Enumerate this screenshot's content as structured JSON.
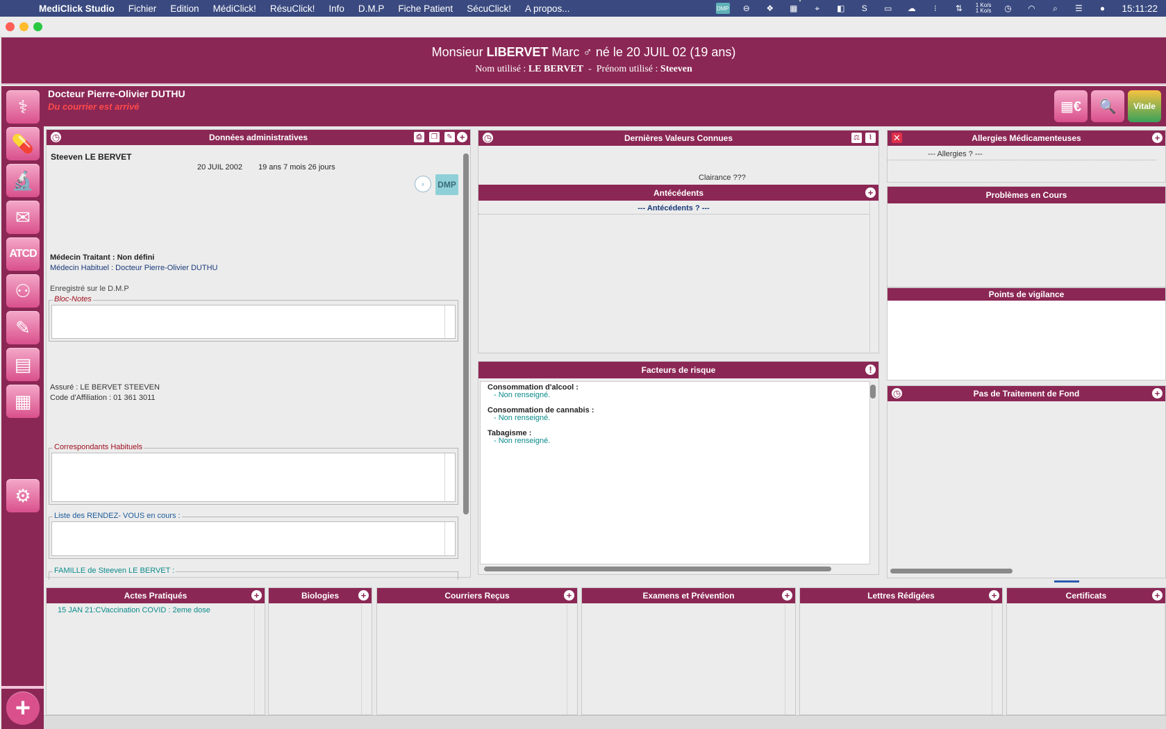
{
  "menubar": {
    "app_name": "MediClick Studio",
    "items": [
      "Fichier",
      "Edition",
      "MédiClick!",
      "RésuClick!",
      "Info",
      "D.M.P",
      "Fiche Patient",
      "SécuClick!",
      "A propos..."
    ],
    "net_up": "1 Ko/s",
    "net_down": "1 Ko/s",
    "clock": "15:11:22",
    "dmp_tray": "DMP"
  },
  "patient": {
    "civility": "Monsieur",
    "last_name": "LIBERVET",
    "first_name": "Marc",
    "sex_symbol": "♂",
    "birth_text": "né le 20 JUIL 02 (19 ans)",
    "used_name_label": "Nom utilisé :",
    "used_name": "LE BERVET",
    "sep": "-",
    "used_first_label": "Prénom utilisé :",
    "used_first": "Steeven"
  },
  "doctor": {
    "name": "Docteur Pierre-Olivier DUTHU",
    "alert": "Du courrier est arrivé"
  },
  "top_tools": {
    "billing": "▦€",
    "search": "🔍",
    "vitale": "Vitale"
  },
  "sidebar": {
    "atcd_label": "ATCD"
  },
  "admin": {
    "title": "Données administratives",
    "patient_name": "Steeven LE BERVET",
    "birth_date": "20 JUIL 2002",
    "age": "19 ans 7 mois 26 jours",
    "dmp_badge": "DMP",
    "treating": "Médecin Traitant : Non défini",
    "usual": "Médecin Habituel : Docteur Pierre-Olivier DUTHU",
    "dmp_registered": "Enregistré sur le D.M.P",
    "bloc_notes": "Bloc-Notes",
    "insured": "Assuré : LE BERVET STEEVEN",
    "affiliation": "Code d'Affiliation : 01  361  3011",
    "correspondants": "Correspondants Habituels",
    "rendez_vous": "Liste des RENDEZ- VOUS en cours :",
    "famille": "FAMILLE de Steeven LE BERVET :"
  },
  "last_values": {
    "title": "Dernières Valeurs Connues",
    "clairance": "Clairance ???"
  },
  "antecedents": {
    "title": "Antécédents",
    "placeholder": "--- Antécédents ? ---"
  },
  "risk": {
    "title": "Facteurs de risque",
    "items": [
      {
        "label": "Consommation d'alcool :",
        "value": "- Non renseigné."
      },
      {
        "label": "Consommation de cannabis :",
        "value": "- Non renseigné."
      },
      {
        "label": "Tabagisme :",
        "value": "- Non renseigné."
      }
    ]
  },
  "allergies": {
    "title": "Allergies Médicamenteuses",
    "placeholder": "--- Allergies ? ---"
  },
  "problems": {
    "title": "Problèmes en Cours"
  },
  "vigilance": {
    "title": "Points de vigilance"
  },
  "treatment": {
    "title": "Pas de Traitement de Fond"
  },
  "bottom": {
    "actes": {
      "title": "Actes Pratiqués",
      "date": "15 JAN 21:C",
      "item": "Vaccination COVID : 2eme dose"
    },
    "biologies": {
      "title": "Biologies"
    },
    "courriers": {
      "title": "Courriers Reçus"
    },
    "examens": {
      "title": "Examens et Prévention"
    },
    "lettres": {
      "title": "Lettres Rédigées"
    },
    "certificats": {
      "title": "Certificats"
    }
  },
  "colors": {
    "accent": "#8b2755",
    "sidebar_button": "#d9508c",
    "alert": "#ff4a4a",
    "teal": "#0b8a8a"
  }
}
